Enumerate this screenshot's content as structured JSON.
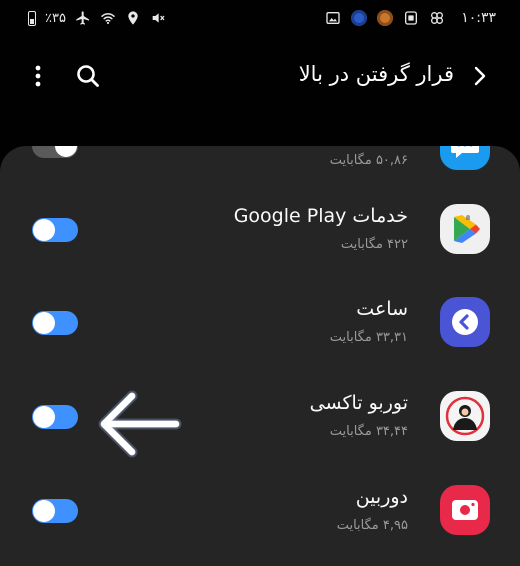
{
  "status_bar": {
    "battery": "٪۳۵",
    "time": "۱۰:۳۳",
    "left_icons": [
      "battery-icon",
      "airplane-mode-icon",
      "wifi-icon",
      "location-icon",
      "mute-icon"
    ],
    "right_icons": [
      "gallery-notification-icon",
      "taxi-app-notification-icon",
      "lion-app-notification-icon",
      "screenshot-notification-icon",
      "pinwheel-notification-icon"
    ]
  },
  "app_bar": {
    "title": "قرار گرفتن در بالا",
    "icons": [
      "back-arrow-icon",
      "search-icon",
      "more-options-icon"
    ]
  },
  "apps": [
    {
      "name": "",
      "size": "۵۰,۸۶ مگابایت",
      "enabled": false,
      "icon": "messaging-app-icon",
      "color": "#1a9bf0"
    },
    {
      "name": "خدمات Google Play",
      "size": "۴۲۲ مگابایت",
      "enabled": true,
      "icon": "google-play-services-icon",
      "color": "#f0f0f0"
    },
    {
      "name": "ساعت",
      "size": "۳۳,۳۱ مگابایت",
      "enabled": true,
      "icon": "clock-app-icon",
      "color": "#4a55d6"
    },
    {
      "name": "توربو تاکسی",
      "size": "۳۴,۴۴ مگابایت",
      "enabled": true,
      "icon": "turbo-taxi-app-icon",
      "color": "#f4f4f4"
    },
    {
      "name": "دوربین",
      "size": "۴,۹۵ مگابایت",
      "enabled": true,
      "icon": "camera-app-icon",
      "color": "#e8294a"
    }
  ],
  "colors": {
    "background": "#010101",
    "panel": "#252525",
    "toggle_on": "#3e91ff",
    "secondary_text": "#9a9a9a"
  },
  "annotation": {
    "icon": "left-arrow-icon",
    "color": "#ffffff"
  }
}
